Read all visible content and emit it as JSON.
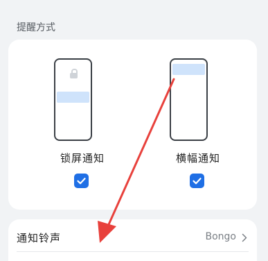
{
  "section": {
    "title": "提醒方式"
  },
  "options": [
    {
      "label": "锁屏通知",
      "checked": true
    },
    {
      "label": "横幅通知",
      "checked": true
    }
  ],
  "ringtone": {
    "label": "通知铃声",
    "value": "Bongo",
    "chevron_icon": "chevron-right-icon"
  },
  "colors": {
    "accent": "#1f6fe5",
    "annotation_arrow": "#e8413c",
    "notification_preview": "#cfe3fb"
  }
}
